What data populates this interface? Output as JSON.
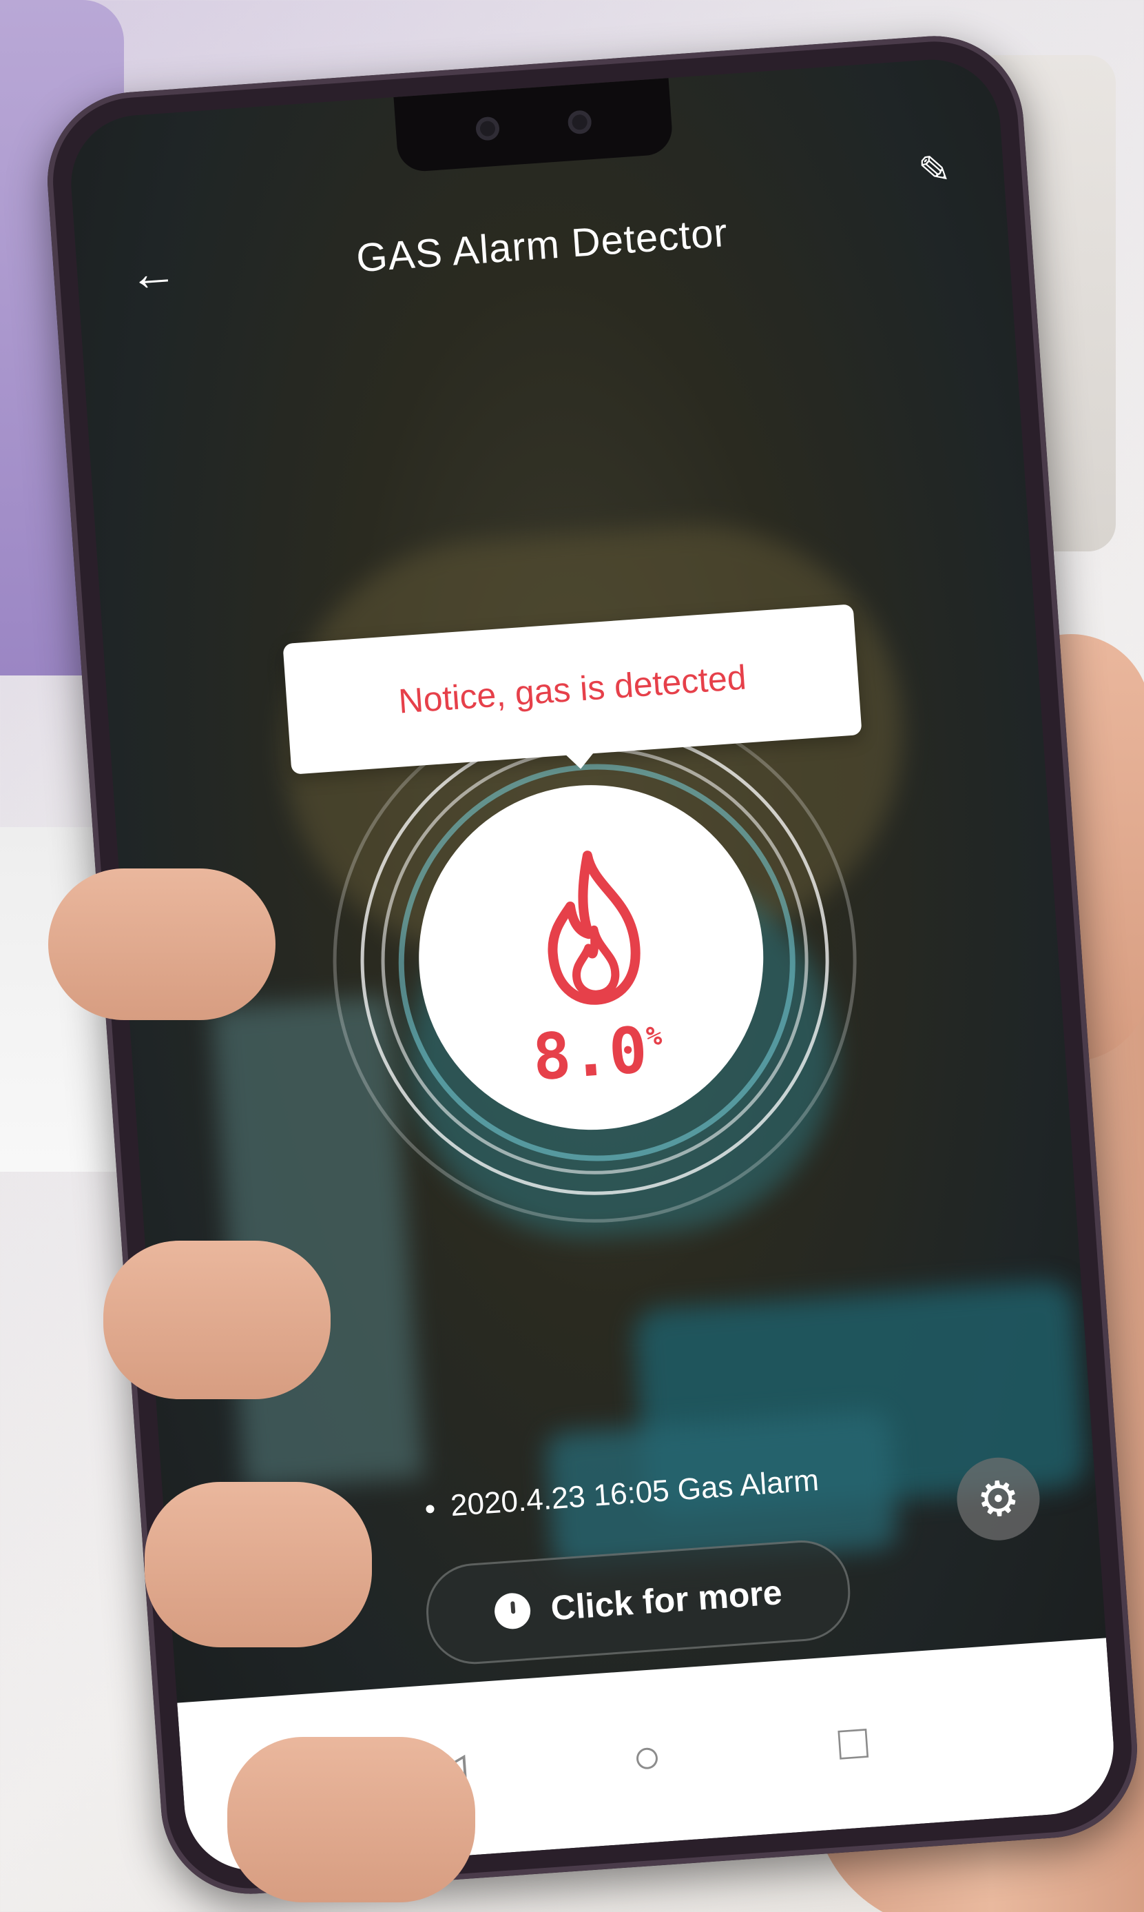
{
  "app": {
    "title": "GAS Alarm Detector"
  },
  "header": {
    "back_icon": "arrow-left-icon",
    "back_glyph": "←",
    "edit_icon": "pencil-icon",
    "edit_glyph": "✎"
  },
  "notice": {
    "text": "Notice, gas is detected"
  },
  "gauge": {
    "value": "8.0",
    "unit": "%",
    "icon": "flame-icon"
  },
  "event": {
    "text": "2020.4.23 16:05 Gas Alarm"
  },
  "actions": {
    "more_label": "Click for more",
    "more_icon": "clock-icon",
    "settings_icon": "gear-icon",
    "settings_glyph": "⚙"
  },
  "nav": {
    "back_glyph": "◁",
    "home_glyph": "○",
    "recent_glyph": "□"
  },
  "colors": {
    "alert": "#e6404a",
    "text_light": "#ffffff"
  }
}
